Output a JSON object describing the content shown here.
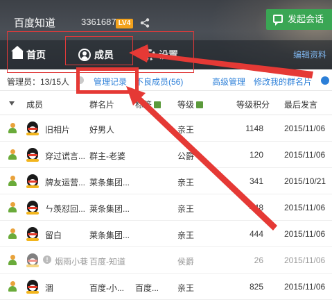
{
  "header": {
    "group_name": "百度知道",
    "group_id": "336168778",
    "level": "LV4",
    "start_chat": "发起会话",
    "tabs": [
      {
        "label": "首页",
        "icon": "home-icon"
      },
      {
        "label": "成员",
        "icon": "user-icon"
      },
      {
        "label": "设置",
        "icon": "gear-icon"
      }
    ],
    "edit_profile": "编辑资料"
  },
  "subbar": {
    "admins": "管理员：13/15人",
    "admin_log": "管理记录",
    "bad_members": "不良成员(56)",
    "advanced": "高级管理",
    "edit_card": "修改我的群名片"
  },
  "table": {
    "columns": [
      "成员",
      "群名片",
      "标签",
      "等级",
      "等级积分",
      "最后发言"
    ],
    "rows": [
      {
        "name": "旧相片",
        "card": "好男人",
        "tag": "",
        "level": "亲王",
        "points": "1148",
        "last": "2015/11/06",
        "dim": false
      },
      {
        "name": "穿过谎言...",
        "card": "群主-老婆",
        "tag": "",
        "level": "公爵",
        "points": "120",
        "last": "2015/11/06",
        "dim": false
      },
      {
        "name": "牌友运营...",
        "card": "莱条集团...",
        "tag": "",
        "level": "亲王",
        "points": "341",
        "last": "2015/10/21",
        "dim": false
      },
      {
        "name": "ㄣ羡怼回...",
        "card": "莱条集团...",
        "tag": "",
        "level": "亲王",
        "points": "448",
        "last": "2015/11/06",
        "dim": false
      },
      {
        "name": "留白",
        "card": "莱条集团...",
        "tag": "",
        "level": "亲王",
        "points": "444",
        "last": "2015/11/06",
        "dim": false
      },
      {
        "name": "烟雨小巷",
        "card": "百度-知道",
        "tag": "",
        "level": "侯爵",
        "points": "26",
        "last": "2015/11/06",
        "dim": true
      },
      {
        "name": "涸",
        "card": "百度-小...",
        "tag": "百度...",
        "level": "亲王",
        "points": "825",
        "last": "2015/11/06",
        "dim": false
      }
    ]
  },
  "colors": {
    "accent_green": "#3aa654",
    "link_blue": "#2c7fd8",
    "annotation_red": "#e53935",
    "badge_orange": "#f3a21c"
  }
}
